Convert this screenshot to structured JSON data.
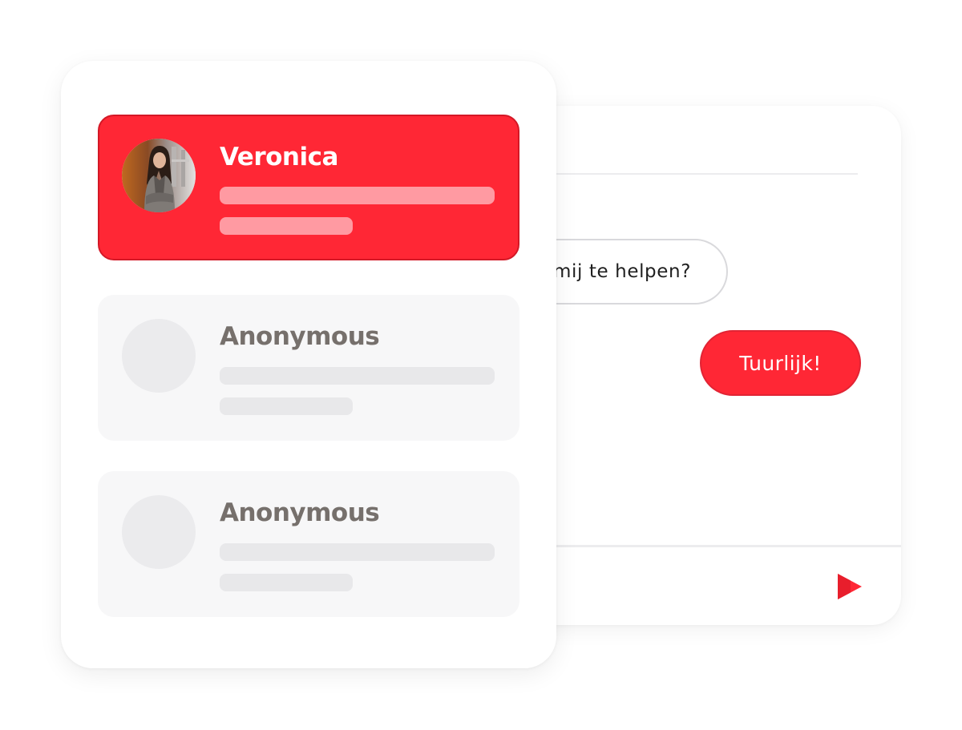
{
  "chat": {
    "incoming_message": "mij te helpen?",
    "outgoing_message": "Tuurlijk!",
    "send_icon": "send-arrow-icon"
  },
  "contacts": [
    {
      "name": "Veronica",
      "active": true,
      "avatar": "user-photo"
    },
    {
      "name": "Anonymous",
      "active": false,
      "avatar": "placeholder-avatar"
    },
    {
      "name": "Anonymous",
      "active": false,
      "avatar": "placeholder-avatar"
    }
  ],
  "colors": {
    "accent": "#ff2735",
    "accent_border": "#d41826",
    "card_background": "#f7f7f8",
    "placeholder": "#e8e8ea",
    "active_placeholder": "#ff9aa2",
    "muted_text": "#76706c"
  }
}
